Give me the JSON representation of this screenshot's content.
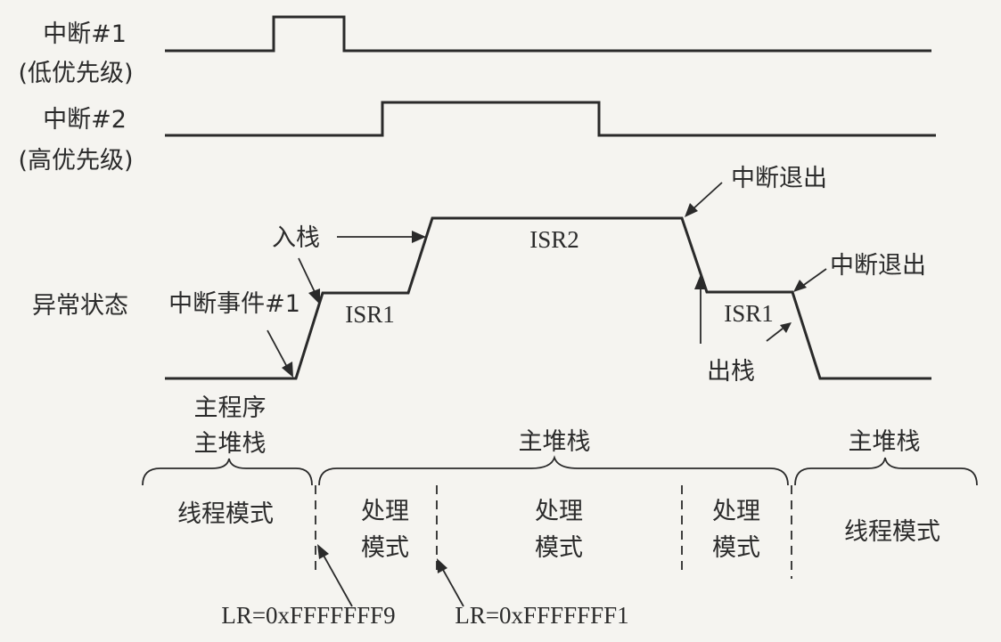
{
  "signals": {
    "int1": {
      "name": "中断#1",
      "priority": "(低优先级)"
    },
    "int2": {
      "name": "中断#2",
      "priority": "(高优先级)"
    },
    "exception": {
      "name": "异常状态"
    }
  },
  "states": {
    "isr1_first": "ISR1",
    "isr2": "ISR2",
    "isr1_second": "ISR1"
  },
  "annotations": {
    "push": "入栈",
    "event1": "中断事件#1",
    "exit_top": "中断退出",
    "exit_right": "中断退出",
    "pop": "出栈"
  },
  "stacks": {
    "main_program": "主程序",
    "main_stack_left": "主堆栈",
    "main_stack_mid": "主堆栈",
    "main_stack_right": "主堆栈"
  },
  "modes": {
    "thread_left": "线程模式",
    "handler1_line1": "处理",
    "handler1_line2": "模式",
    "handler2_line1": "处理",
    "handler2_line2": "模式",
    "handler3_line1": "处理",
    "handler3_line2": "模式",
    "thread_right": "线程模式"
  },
  "lr_values": {
    "lr1": "LR=0xFFFFFFF9",
    "lr2": "LR=0xFFFFFFF1"
  }
}
